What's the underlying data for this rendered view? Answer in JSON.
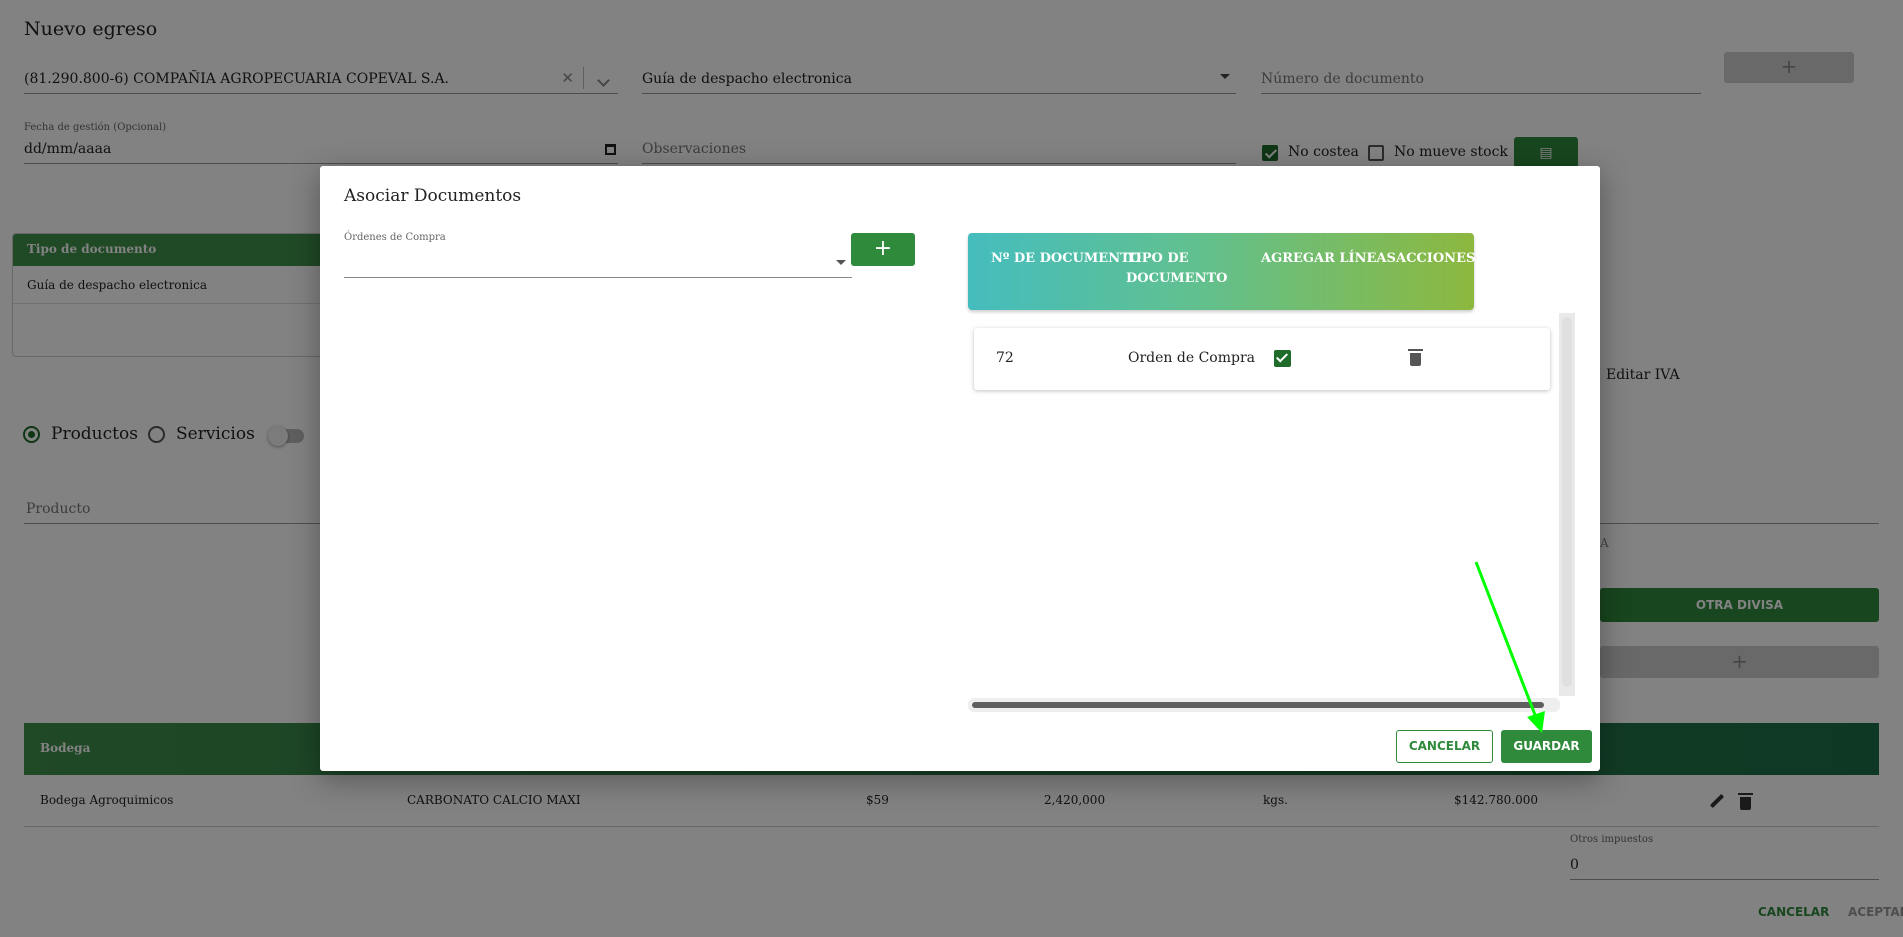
{
  "page": {
    "title": "Nuevo egreso",
    "supplier": {
      "value": "(81.290.800-6) COMPAÑIA AGROPECUARIA COPEVAL S.A."
    },
    "doc_type": {
      "label": "Tipo de documento",
      "value": "Guía de despacho electronica"
    },
    "doc_number": {
      "placeholder": "Número de documento"
    },
    "mgmt_date": {
      "label": "Fecha de gestión (Opcional)",
      "value": "dd/mm/aaaa"
    },
    "observations": {
      "placeholder": "Observaciones"
    },
    "no_costea": "No costea",
    "no_mueve_stock": "No mueve stock",
    "small_table": {
      "header": "Tipo de documento",
      "row": "Guía de despacho electronica"
    },
    "editar_iva": "Editar IVA",
    "radio_productos": "Productos",
    "radio_servicios": "Servicios",
    "producto_placeholder": "Producto",
    "partial_a": "A",
    "otra_divisa": "OTRA DIVISA",
    "bodega": {
      "header": "Bodega",
      "row": {
        "bodega": "Bodega Agroquimicos",
        "producto": "CARBONATO CALCIO MAXI",
        "precio": "$59",
        "cantidad": "2,420,000",
        "unidad": "kgs.",
        "total": "$142.780.000"
      }
    },
    "otros_impuestos": {
      "label": "Otros impuestos",
      "value": "0"
    },
    "footer": {
      "cancel": "CANCELAR",
      "accept": "ACEPTAR"
    }
  },
  "modal": {
    "title": "Asociar Documentos",
    "ordenes_label": "Órdenes de Compra",
    "add_symbol": "+",
    "table": {
      "headers": [
        "Nº DE DOCUMENTO",
        "TIPO DE DOCUMENTO",
        "AGREGAR LÍNEAS",
        "ACCIONES"
      ],
      "rows": [
        {
          "numero": "72",
          "tipo": "Orden de Compra",
          "agregar_lineas": true
        }
      ]
    },
    "buttons": {
      "cancel": "CANCELAR",
      "save": "GUARDAR"
    }
  },
  "colors": {
    "primary_green": "#2f8a3c",
    "dark_green": "#1e6b2a",
    "annotation_arrow": "#00ff00"
  }
}
